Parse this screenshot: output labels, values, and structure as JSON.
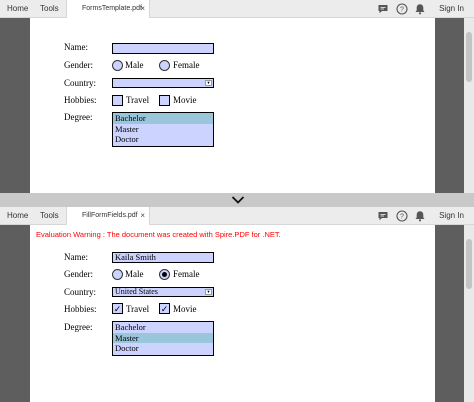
{
  "top": {
    "nav": {
      "home": "Home",
      "tools": "Tools"
    },
    "tab": {
      "filename": "FormsTemplate.pdf",
      "close": "×"
    },
    "signin": "Sign In",
    "form": {
      "name_label": "Name:",
      "name_value": "",
      "gender_label": "Gender:",
      "gender_male": "Male",
      "gender_female": "Female",
      "country_label": "Country:",
      "country_value": "",
      "hobbies_label": "Hobbies:",
      "hobby_travel": "Travel",
      "hobby_movie": "Movie",
      "degree_label": "Degree:",
      "degree_options": [
        "Bachelor",
        "Master",
        "Doctor"
      ]
    }
  },
  "bottom": {
    "nav": {
      "home": "Home",
      "tools": "Tools"
    },
    "tab": {
      "filename": "FillFormFields.pdf",
      "close": "×"
    },
    "signin": "Sign In",
    "warning": "Evaluation Warning : The document was created with Spire.PDF for .NET.",
    "form": {
      "name_label": "Name:",
      "name_value": "Kaila Smith",
      "gender_label": "Gender:",
      "gender_male": "Male",
      "gender_female": "Female",
      "country_label": "Country:",
      "country_value": "United States",
      "hobbies_label": "Hobbies:",
      "hobby_travel": "Travel",
      "hobby_movie": "Movie",
      "check_mark": "✓",
      "degree_label": "Degree:",
      "degree_options": [
        "Bachelor",
        "Master",
        "Doctor"
      ]
    }
  },
  "icons": {
    "comment": "comment-icon",
    "help": "help-icon",
    "bell": "bell-icon",
    "chevron": "chevron-down-icon",
    "dropdown": "dropdown-arrow-icon"
  },
  "colors": {
    "field_fill": "#cdd3ff",
    "selected_option": "#9ac6dc",
    "warning_text": "#ff0000",
    "viewer_background": "#5e5e5e"
  }
}
